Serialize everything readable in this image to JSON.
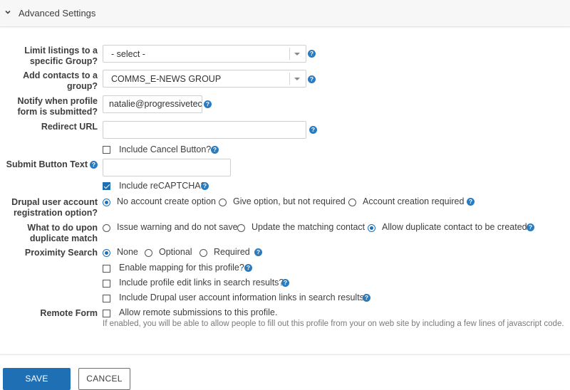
{
  "section": {
    "title": "Advanced Settings",
    "collapse_icon": "chevron-down-icon"
  },
  "fields": {
    "limit_group": {
      "label_line1": "Limit listings to a",
      "label_line2": "specific Group?",
      "value": "- select -"
    },
    "add_contacts": {
      "label_line1": "Add contacts to a",
      "label_line2": "group?",
      "value": "COMMS_E-NEWS GROUP"
    },
    "notify": {
      "label_line1": "Notify when profile",
      "label_line2": "form is submitted?",
      "value": "natalie@progressivetech"
    },
    "redirect": {
      "label": "Redirect URL",
      "value": ""
    },
    "cancel_button": {
      "label": "Include Cancel Button?",
      "checked": false
    },
    "submit_text": {
      "label": "Submit Button Text",
      "value": ""
    },
    "recaptcha": {
      "label": "Include reCAPTCHA?",
      "checked": true
    },
    "drupal_registration": {
      "label_line1": "Drupal user account",
      "label_line2": "registration option?",
      "options": [
        "No account create option",
        "Give option, but not required",
        "Account creation required"
      ],
      "selected": 0
    },
    "duplicate": {
      "label_line1": "What to do upon",
      "label_line2": "duplicate match",
      "options": [
        "Issue warning and do not save",
        "Update the matching contact",
        "Allow duplicate contact to be created"
      ],
      "selected": 2
    },
    "proximity": {
      "label": "Proximity Search",
      "options": [
        "None",
        "Optional",
        "Required"
      ],
      "selected": 0
    },
    "mapping": {
      "label": "Enable mapping for this profile?",
      "checked": false
    },
    "edit_links": {
      "label": "Include profile edit links in search results?",
      "checked": false
    },
    "drupal_links": {
      "label": "Include Drupal user account information links in search results?",
      "checked": false
    },
    "remote_form": {
      "label": "Remote Form",
      "checkbox_label": "Allow remote submissions to this profile.",
      "checked": false,
      "description": "If enabled, you will be able to allow people to fill out this profile from your on web site by including a few lines of javascript code."
    }
  },
  "help_icon": "?",
  "footer": {
    "save_label": "SAVE",
    "cancel_label": "CANCEL"
  },
  "colors": {
    "accent": "#1f6fb5",
    "help_icon": "#2b7bbf",
    "text": "#3e3e3e"
  }
}
